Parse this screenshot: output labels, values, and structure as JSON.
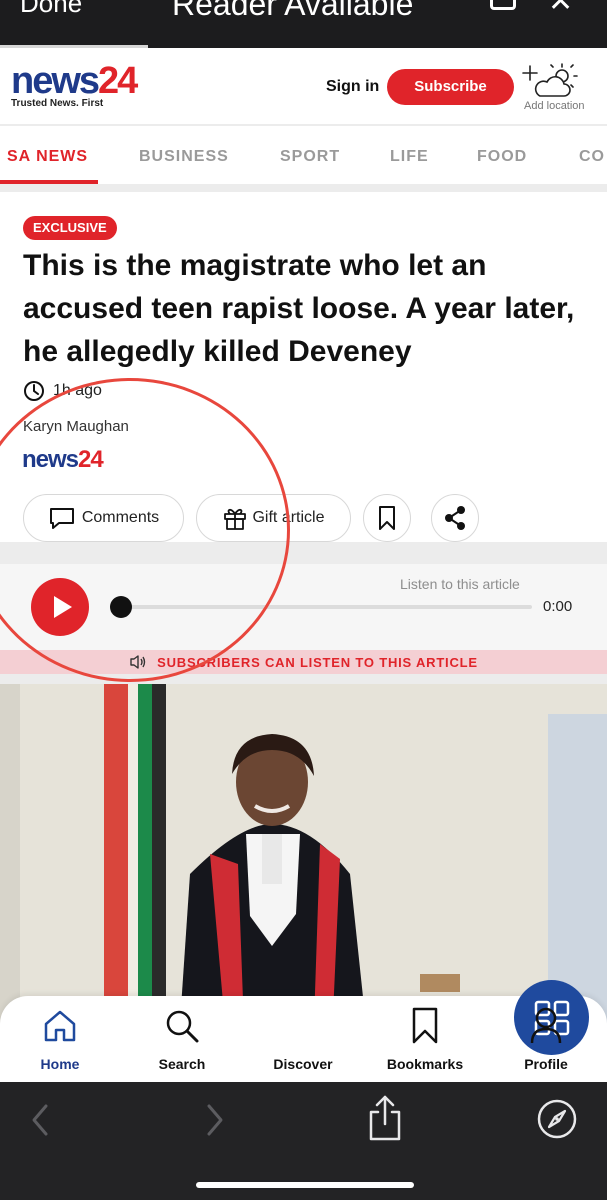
{
  "browser": {
    "done_label": "Done",
    "title": "Reader Available"
  },
  "header": {
    "logo_main": "news",
    "logo_number": "24",
    "logo_tagline": "Trusted News. First",
    "signin_label": "Sign in",
    "subscribe_label": "Subscribe",
    "add_location_label": "Add location"
  },
  "nav": {
    "items": [
      "SA NEWS",
      "BUSINESS",
      "SPORT",
      "LIFE",
      "FOOD",
      "CO"
    ]
  },
  "article": {
    "badge": "EXCLUSIVE",
    "headline": "This is the magistrate who let an accused teen rapist loose. A year later, he allegedly killed Deveney",
    "time": "1h ago",
    "author": "Karyn Maughan",
    "publisher_main": "news",
    "publisher_number": "24",
    "comments_label": "Comments",
    "gift_label": "Gift article"
  },
  "player": {
    "listen_label": "Listen to this article",
    "time": "0:00",
    "progress": 0,
    "subscribers_banner": "SUBSCRIBERS CAN LISTEN TO THIS ARTICLE"
  },
  "tabbar": {
    "items": [
      {
        "label": "Home",
        "icon": "home-icon",
        "active": true
      },
      {
        "label": "Search",
        "icon": "search-icon",
        "active": false
      },
      {
        "label": "Discover",
        "icon": "grid-icon",
        "active": false
      },
      {
        "label": "Bookmarks",
        "icon": "bookmark-icon",
        "active": false
      },
      {
        "label": "Profile",
        "icon": "profile-icon",
        "active": false
      }
    ]
  },
  "colors": {
    "brand_red": "#e0242a",
    "brand_blue": "#1f3a8a",
    "annotation_circle": "#e8473d"
  }
}
